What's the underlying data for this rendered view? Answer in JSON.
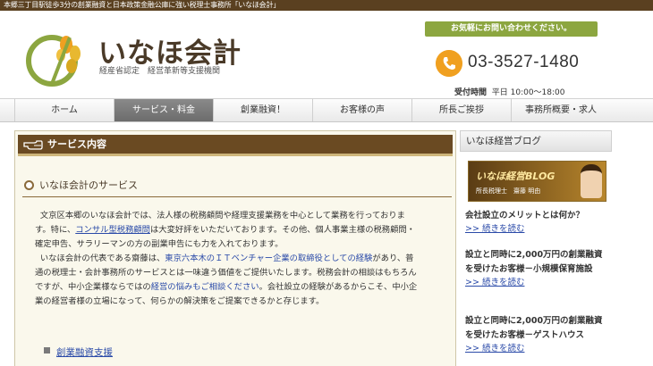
{
  "topbar": {
    "text": "本郷三丁目駅徒歩3分の創業融資と日本政策金融公庫に強い税理士事務所「いなほ会計」"
  },
  "header": {
    "logo_name": "いなほ会計",
    "logo_sub": "経産省認定　経営革新等支援機関",
    "contact_banner": "お気軽にお問い合わせください。",
    "phone": "03-3527-1480",
    "hours_label": "受付時間",
    "hours_value": "平日 10:00～18:00"
  },
  "nav": {
    "items": [
      {
        "label": "ホーム"
      },
      {
        "label": "サービス・料金"
      },
      {
        "label": "創業融資！"
      },
      {
        "label": "お客様の声"
      },
      {
        "label": "所長ご挨拶"
      },
      {
        "label": "事務所概要・求人"
      }
    ]
  },
  "main": {
    "section_title": "サービス内容",
    "subhead": "いなほ会計のサービス",
    "intro": {
      "p1_a": "文京区本郷のいなほ会計では、法人様の税務顧問や経理支援業務を中心として業務を行っておりま",
      "p1_b": "す。特に、",
      "p1_link": "コンサル型税務顧問",
      "p1_c": "は大変好評をいただいております。その他、個人事業主様の税務顧問・",
      "p1_d": "確定申告、サラリーマンの方の副業申告にも力を入れております。",
      "p2_a": "いなほ会計の代表である齋藤は、",
      "p2_hl": "東京六本木のＩＴベンチャー企業の取締役としての経験",
      "p2_b": "があり、普",
      "p2_c": "通の税理士・会計事務所のサービスとは一味違う価値をご提供いたします。税務会計の相談はもちろん",
      "p2_d": "ですが、中小企業様ならではの",
      "p2_hl2": "経営の悩みもご相談ください",
      "p2_e": "。会社設立の経験があるからこそ、中小企",
      "p2_f": "業の経営者様の立場になって、何らかの解決策をご提案できるかと存じます。"
    },
    "service_link": "創業融資支援"
  },
  "side": {
    "title": "いなほ経営ブログ",
    "banner_title": "いなほ経営BLOG",
    "banner_sub": "所長税理士　齋藤 明由",
    "posts": [
      {
        "title": "会社設立のメリットとは何か？",
        "more": ">> 続きを読む"
      },
      {
        "title": "設立と同時に2,000万円の創業融資を受けたお客様－小規模保育施設",
        "more": ">> 続きを読む"
      },
      {
        "title": "設立と同時に2,000万円の創業融資を受けたお客様－ゲストハウス",
        "more": ">> 続きを読む"
      }
    ]
  },
  "colors": {
    "brand_brown": "#6a4a22",
    "accent_green": "#8ca640",
    "phone_orange": "#f0a020",
    "link_blue": "#2a4aa8"
  }
}
